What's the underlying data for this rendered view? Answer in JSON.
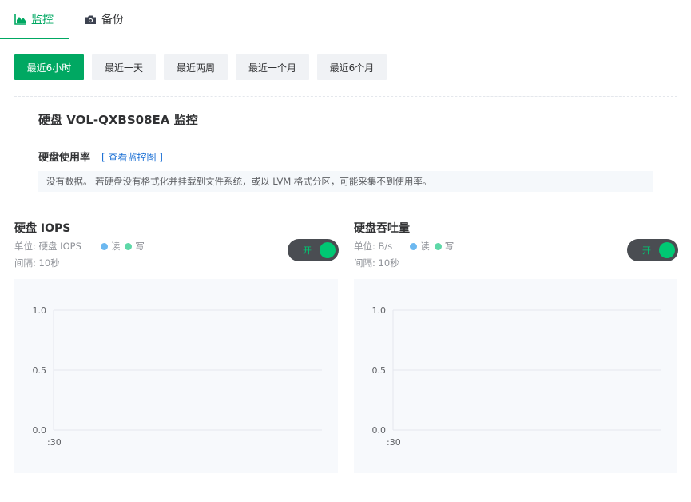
{
  "tabs": [
    {
      "label": "监控",
      "icon": "area-chart-icon",
      "active": true
    },
    {
      "label": "备份",
      "icon": "camera-icon",
      "active": false
    }
  ],
  "time_ranges": [
    {
      "label": "最近6小时",
      "active": true
    },
    {
      "label": "最近一天",
      "active": false
    },
    {
      "label": "最近两周",
      "active": false
    },
    {
      "label": "最近一个月",
      "active": false
    },
    {
      "label": "最近6个月",
      "active": false
    }
  ],
  "disk": {
    "title": "硬盘 VOL-QXBS08EA 监控",
    "usage_title": "硬盘使用率",
    "usage_link": "[ 查看监控图 ]",
    "no_data_text": "没有数据。 若硬盘没有格式化并挂载到文件系统，或以 LVM 格式分区，可能采集不到使用率。"
  },
  "colors": {
    "accent": "#00a862",
    "read": "#6cb8f0",
    "write": "#5ed8a8",
    "toggle_bg": "#4a4d52"
  },
  "panels": [
    {
      "title": "硬盘 IOPS",
      "unit": "单位: 硬盘 IOPS",
      "interval": "间隔: 10秒",
      "legend_read": "读",
      "legend_write": "写",
      "toggle_label": "开",
      "toggle_on": true
    },
    {
      "title": "硬盘吞吐量",
      "unit": "单位: B/s",
      "interval": "间隔: 10秒",
      "legend_read": "读",
      "legend_write": "写",
      "toggle_label": "开",
      "toggle_on": true
    }
  ],
  "chart_data": [
    {
      "type": "line",
      "title": "硬盘 IOPS",
      "x_ticks": [
        ":30"
      ],
      "y_ticks": [
        "1.0",
        "0.5",
        "0.0"
      ],
      "ylim": [
        0,
        1
      ],
      "series": [
        {
          "name": "读",
          "values": []
        },
        {
          "name": "写",
          "values": []
        }
      ],
      "grid": true
    },
    {
      "type": "line",
      "title": "硬盘吞吐量",
      "x_ticks": [
        ":30"
      ],
      "y_ticks": [
        "1.0",
        "0.5",
        "0.0"
      ],
      "ylim": [
        0,
        1
      ],
      "series": [
        {
          "name": "读",
          "values": []
        },
        {
          "name": "写",
          "values": []
        }
      ],
      "grid": true
    }
  ]
}
